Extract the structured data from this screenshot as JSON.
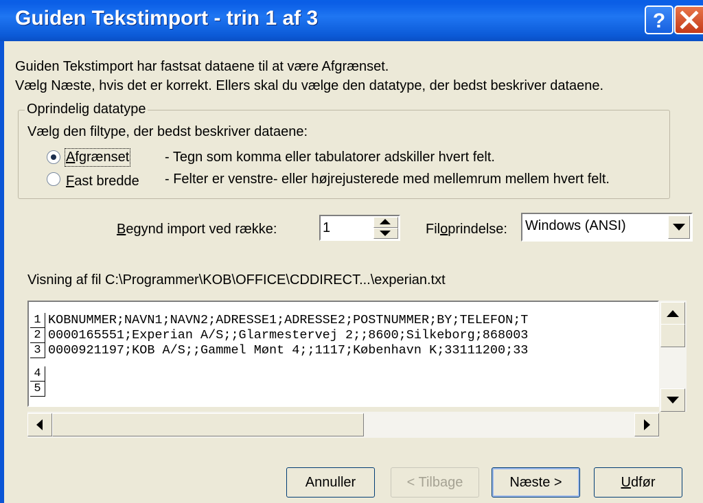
{
  "window": {
    "title": "Guiden Tekstimport - trin 1 af 3",
    "help_icon": "help-icon",
    "close_icon": "close-icon"
  },
  "intro": {
    "line1": "Guiden Tekstimport har fastsat dataene til at være Afgrænset.",
    "line2": "Vælg Næste, hvis det er korrekt. Ellers skal du vælge den datatype, der bedst beskriver dataene."
  },
  "datatype_group": {
    "legend": "Oprindelig datatype",
    "prompt": "Vælg den filtype, der bedst beskriver dataene:",
    "options": [
      {
        "label": "Afgrænset",
        "accel": "A",
        "rest": "fgrænset",
        "description": "- Tegn som komma eller tabulatorer adskiller hvert felt.",
        "selected": true
      },
      {
        "label": "Fast bredde",
        "accel": "F",
        "rest": "ast bredde",
        "description": "- Felter er venstre- eller højrejusterede med mellemrum mellem hvert felt.",
        "selected": false
      }
    ]
  },
  "import": {
    "start_row_label": "Begynd import ved række:",
    "start_row_accel": "B",
    "start_row_rest": "egynd import ved række:",
    "start_row_value": "1",
    "origin_label_pre": "Fil",
    "origin_label_accel": "o",
    "origin_label_post": "prindelse:",
    "origin_value": "Windows (ANSI)"
  },
  "preview": {
    "label": "Visning af fil C:\\Programmer\\KOB\\OFFICE\\CDDIRECT...\\experian.txt",
    "rows": [
      {
        "num": "1",
        "text": "KOBNUMMER;NAVN1;NAVN2;ADRESSE1;ADRESSE2;POSTNUMMER;BY;TELEFON;T"
      },
      {
        "num": "2",
        "text": "0000165551;Experian A/S;;Glarmestervej 2;;8600;Silkeborg;868003"
      },
      {
        "num": "3",
        "text": "0000921197;KOB A/S;;Gammel Mønt 4;;1117;København K;33111200;33"
      },
      {
        "num": "4",
        "text": ""
      },
      {
        "num": "5",
        "text": ""
      }
    ]
  },
  "buttons": {
    "cancel": "Annuller",
    "back": "< Tilbage",
    "next": "Næste >",
    "finish_accel": "U",
    "finish_rest": "dfør"
  }
}
